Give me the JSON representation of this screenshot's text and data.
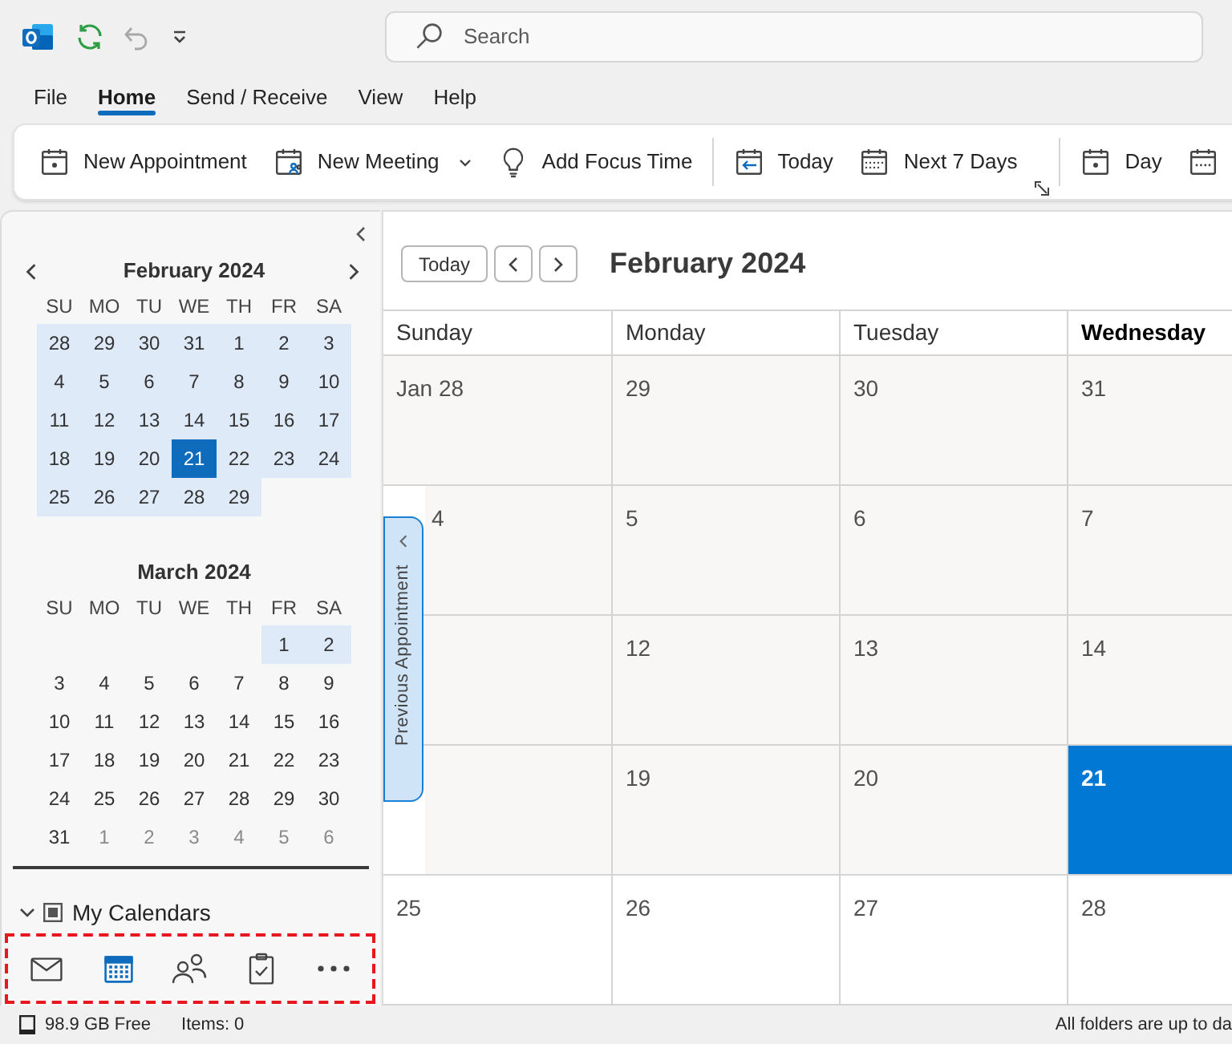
{
  "title_bar": {
    "quick_access": [
      {
        "kind": "sync",
        "disabled": false
      },
      {
        "kind": "undo",
        "disabled": true
      },
      {
        "kind": "customize",
        "disabled": false
      }
    ],
    "search": {
      "placeholder": "Search"
    }
  },
  "menu_tabs": [
    {
      "label": "File",
      "selected": false
    },
    {
      "label": "Home",
      "selected": true
    },
    {
      "label": "Send / Receive",
      "selected": false
    },
    {
      "label": "View",
      "selected": false
    },
    {
      "label": "Help",
      "selected": false
    }
  ],
  "ribbon": {
    "groups": [
      {
        "launcher": false,
        "items": [
          {
            "kind": "appointment",
            "label": "New Appointment",
            "has_menu": false
          },
          {
            "kind": "meeting",
            "label": "New Meeting",
            "has_menu": true
          },
          {
            "kind": "focus",
            "label": "Add Focus Time",
            "has_menu": false
          }
        ]
      },
      {
        "launcher": true,
        "items": [
          {
            "kind": "today",
            "label": "Today",
            "has_menu": false
          },
          {
            "kind": "week",
            "label": "Next 7 Days",
            "has_menu": false
          }
        ]
      },
      {
        "launcher": false,
        "items": [
          {
            "kind": "day",
            "label": "Day",
            "has_menu": false
          },
          {
            "kind": "work_week",
            "has_menu": false
          }
        ]
      }
    ]
  },
  "sidebar": {
    "mini_calendars": [
      {
        "title": "February 2024",
        "nav_arrows": true,
        "weekdays": [
          "SU",
          "MO",
          "TU",
          "WE",
          "TH",
          "FR",
          "SA"
        ],
        "weeks": [
          [
            {
              "day": "28",
              "highlighted": true,
              "selected": false,
              "muted": false
            },
            {
              "day": "29",
              "highlighted": true,
              "selected": false,
              "muted": false
            },
            {
              "day": "30",
              "highlighted": true,
              "selected": false,
              "muted": false
            },
            {
              "day": "31",
              "highlighted": true,
              "selected": false,
              "muted": false
            },
            {
              "day": "1",
              "highlighted": true,
              "selected": false,
              "muted": false
            },
            {
              "day": "2",
              "highlighted": true,
              "selected": false,
              "muted": false
            },
            {
              "day": "3",
              "highlighted": true,
              "selected": false,
              "muted": false
            }
          ],
          [
            {
              "day": "4",
              "highlighted": true,
              "selected": false,
              "muted": false
            },
            {
              "day": "5",
              "highlighted": true,
              "selected": false,
              "muted": false
            },
            {
              "day": "6",
              "highlighted": true,
              "selected": false,
              "muted": false
            },
            {
              "day": "7",
              "highlighted": true,
              "selected": false,
              "muted": false
            },
            {
              "day": "8",
              "highlighted": true,
              "selected": false,
              "muted": false
            },
            {
              "day": "9",
              "highlighted": true,
              "selected": false,
              "muted": false
            },
            {
              "day": "10",
              "highlighted": true,
              "selected": false,
              "muted": false
            }
          ],
          [
            {
              "day": "11",
              "highlighted": true,
              "selected": false,
              "muted": false
            },
            {
              "day": "12",
              "highlighted": true,
              "selected": false,
              "muted": false
            },
            {
              "day": "13",
              "highlighted": true,
              "selected": false,
              "muted": false
            },
            {
              "day": "14",
              "highlighted": true,
              "selected": false,
              "muted": false
            },
            {
              "day": "15",
              "highlighted": true,
              "selected": false,
              "muted": false
            },
            {
              "day": "16",
              "highlighted": true,
              "selected": false,
              "muted": false
            },
            {
              "day": "17",
              "highlighted": true,
              "selected": false,
              "muted": false
            }
          ],
          [
            {
              "day": "18",
              "highlighted": true,
              "selected": false,
              "muted": false
            },
            {
              "day": "19",
              "highlighted": true,
              "selected": false,
              "muted": false
            },
            {
              "day": "20",
              "highlighted": true,
              "selected": false,
              "muted": false
            },
            {
              "day": "21",
              "highlighted": true,
              "selected": true,
              "muted": false
            },
            {
              "day": "22",
              "highlighted": true,
              "selected": false,
              "muted": false
            },
            {
              "day": "23",
              "highlighted": true,
              "selected": false,
              "muted": false
            },
            {
              "day": "24",
              "highlighted": true,
              "selected": false,
              "muted": false
            }
          ],
          [
            {
              "day": "25",
              "highlighted": true,
              "selected": false,
              "muted": false
            },
            {
              "day": "26",
              "highlighted": true,
              "selected": false,
              "muted": false
            },
            {
              "day": "27",
              "highlighted": true,
              "selected": false,
              "muted": false
            },
            {
              "day": "28",
              "highlighted": true,
              "selected": false,
              "muted": false
            },
            {
              "day": "29",
              "highlighted": true,
              "selected": false,
              "muted": false
            }
          ]
        ]
      },
      {
        "title": "March 2024",
        "nav_arrows": false,
        "weekdays": [
          "SU",
          "MO",
          "TU",
          "WE",
          "TH",
          "FR",
          "SA"
        ],
        "weeks": [
          [
            {
              "day": "1",
              "highlighted": true,
              "selected": false,
              "muted": false
            },
            {
              "day": "2",
              "highlighted": true,
              "selected": false,
              "muted": false
            }
          ],
          [
            {
              "day": "3",
              "highlighted": false,
              "selected": false,
              "muted": false
            },
            {
              "day": "4",
              "highlighted": false,
              "selected": false,
              "muted": false
            },
            {
              "day": "5",
              "highlighted": false,
              "selected": false,
              "muted": false
            },
            {
              "day": "6",
              "highlighted": false,
              "selected": false,
              "muted": false
            },
            {
              "day": "7",
              "highlighted": false,
              "selected": false,
              "muted": false
            },
            {
              "day": "8",
              "highlighted": false,
              "selected": false,
              "muted": false
            },
            {
              "day": "9",
              "highlighted": false,
              "selected": false,
              "muted": false
            }
          ],
          [
            {
              "day": "10",
              "highlighted": false,
              "selected": false,
              "muted": false
            },
            {
              "day": "11",
              "highlighted": false,
              "selected": false,
              "muted": false
            },
            {
              "day": "12",
              "highlighted": false,
              "selected": false,
              "muted": false
            },
            {
              "day": "13",
              "highlighted": false,
              "selected": false,
              "muted": false
            },
            {
              "day": "14",
              "highlighted": false,
              "selected": false,
              "muted": false
            },
            {
              "day": "15",
              "highlighted": false,
              "selected": false,
              "muted": false
            },
            {
              "day": "16",
              "highlighted": false,
              "selected": false,
              "muted": false
            }
          ],
          [
            {
              "day": "17",
              "highlighted": false,
              "selected": false,
              "muted": false
            },
            {
              "day": "18",
              "highlighted": false,
              "selected": false,
              "muted": false
            },
            {
              "day": "19",
              "highlighted": false,
              "selected": false,
              "muted": false
            },
            {
              "day": "20",
              "highlighted": false,
              "selected": false,
              "muted": false
            },
            {
              "day": "21",
              "highlighted": false,
              "selected": false,
              "muted": false
            },
            {
              "day": "22",
              "highlighted": false,
              "selected": false,
              "muted": false
            },
            {
              "day": "23",
              "highlighted": false,
              "selected": false,
              "muted": false
            }
          ],
          [
            {
              "day": "24",
              "highlighted": false,
              "selected": false,
              "muted": false
            },
            {
              "day": "25",
              "highlighted": false,
              "selected": false,
              "muted": false
            },
            {
              "day": "26",
              "highlighted": false,
              "selected": false,
              "muted": false
            },
            {
              "day": "27",
              "highlighted": false,
              "selected": false,
              "muted": false
            },
            {
              "day": "28",
              "highlighted": false,
              "selected": false,
              "muted": false
            },
            {
              "day": "29",
              "highlighted": false,
              "selected": false,
              "muted": false
            },
            {
              "day": "30",
              "highlighted": false,
              "selected": false,
              "muted": false
            }
          ],
          [
            {
              "day": "31",
              "highlighted": false,
              "selected": false,
              "muted": false
            },
            {
              "day": "1",
              "highlighted": false,
              "selected": false,
              "muted": true
            },
            {
              "day": "2",
              "highlighted": false,
              "selected": false,
              "muted": true
            },
            {
              "day": "3",
              "highlighted": false,
              "selected": false,
              "muted": true
            },
            {
              "day": "4",
              "highlighted": false,
              "selected": false,
              "muted": true
            },
            {
              "day": "5",
              "highlighted": false,
              "selected": false,
              "muted": true
            },
            {
              "day": "6",
              "highlighted": false,
              "selected": false,
              "muted": true
            }
          ]
        ]
      }
    ],
    "my_calendars": {
      "label": "My Calendars",
      "expanded": true,
      "indeterminate": true
    },
    "navigation": {
      "highlighted": true,
      "items": [
        {
          "kind": "mail",
          "selected": false
        },
        {
          "kind": "calendar",
          "selected": true
        },
        {
          "kind": "people",
          "selected": false
        },
        {
          "kind": "tasks",
          "selected": false
        },
        {
          "kind": "more",
          "selected": false
        }
      ]
    }
  },
  "calendar": {
    "today_button": "Today",
    "title": "February 2024",
    "columns": [
      {
        "label": "Sunday",
        "current": false
      },
      {
        "label": "Monday",
        "current": false
      },
      {
        "label": "Tuesday",
        "current": false
      },
      {
        "label": "Wednesday",
        "current": true
      }
    ],
    "weeks": [
      [
        {
          "label": "Jan 28",
          "kind": "past"
        },
        {
          "label": "29",
          "kind": "past"
        },
        {
          "label": "30",
          "kind": "past"
        },
        {
          "label": "31",
          "kind": "past"
        }
      ],
      [
        {
          "label": "4",
          "kind": "past"
        },
        {
          "label": "5",
          "kind": "past"
        },
        {
          "label": "6",
          "kind": "past"
        },
        {
          "label": "7",
          "kind": "past"
        }
      ],
      [
        {
          "kind": "past"
        },
        {
          "label": "12",
          "kind": "past"
        },
        {
          "label": "13",
          "kind": "past"
        },
        {
          "label": "14",
          "kind": "past"
        }
      ],
      [
        {
          "kind": "past"
        },
        {
          "label": "19",
          "kind": "past"
        },
        {
          "label": "20",
          "kind": "past"
        },
        {
          "label": "21",
          "kind": "today"
        }
      ],
      [
        {
          "label": "25",
          "kind": "future"
        },
        {
          "label": "26",
          "kind": "future"
        },
        {
          "label": "27",
          "kind": "future"
        },
        {
          "label": "28",
          "kind": "future"
        }
      ]
    ],
    "side_tab": {
      "label": "Previous Appointment"
    }
  },
  "status_bar": {
    "storage": "98.9 GB Free",
    "items": "Items: 0",
    "sync_status": "All folders are up to da"
  }
}
